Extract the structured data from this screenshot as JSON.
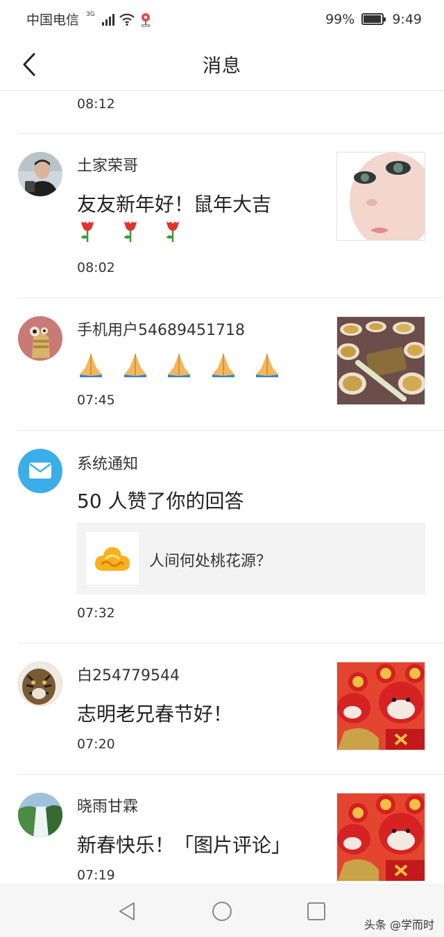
{
  "status_bar": {
    "carrier": "中国电信",
    "network": "3G",
    "battery": "99%",
    "time": "9:49",
    "battery_level": 0.99
  },
  "nav": {
    "title": "消息",
    "back_icon": "chevron-left-icon"
  },
  "messages": [
    {
      "time": "08:12"
    },
    {
      "user": "土家荣哥",
      "text": "友友新年好！鼠年大吉",
      "emoji": "🌷🌷🌷",
      "time": "08:02",
      "thumb": "baby-face-photo"
    },
    {
      "user": "手机用户54689451718",
      "emoji": "🙏🙏🙏🙏🙏",
      "time": "07:45",
      "thumb": "food-dishes-photo"
    },
    {
      "user": "系统通知",
      "text": "50 人赞了你的回答",
      "ref_title": "人间何处桃花源？",
      "time": "07:32"
    },
    {
      "user": "白254779544",
      "text": "志明老兄春节好！",
      "time": "07:20",
      "thumb": "red-mouse-dolls-photo"
    },
    {
      "user": "晓雨甘霖",
      "text": "新春快乐！「图片评论」",
      "time": "07:19",
      "thumb": "red-mouse-dolls-photo"
    }
  ],
  "watermark": "头条 @学而时",
  "colors": {
    "system_avatar": "#3aaee8",
    "ref_bg": "#f3f3f3",
    "divider": "#e8e8e8"
  }
}
